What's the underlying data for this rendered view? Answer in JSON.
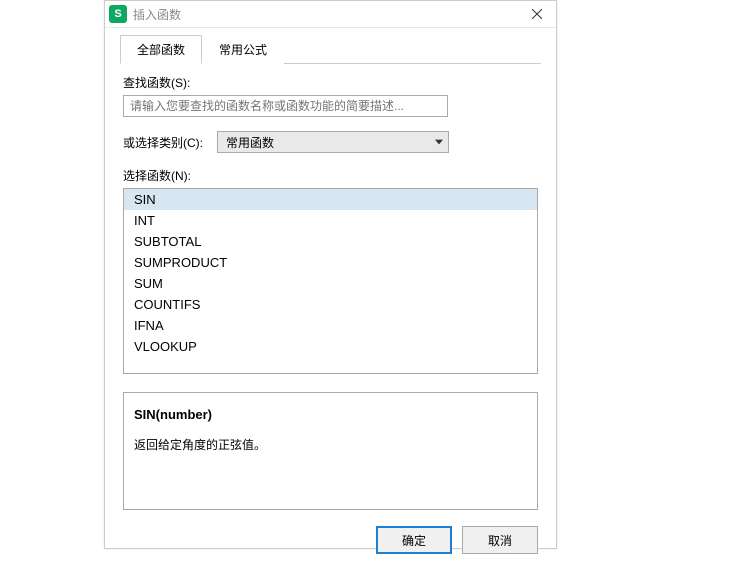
{
  "window": {
    "title": "插入函数"
  },
  "tabs": [
    {
      "label": "全部函数",
      "active": true
    },
    {
      "label": "常用公式",
      "active": false
    }
  ],
  "search": {
    "label": "查找函数(S):",
    "placeholder": "请输入您要查找的函数名称或函数功能的简要描述..."
  },
  "category": {
    "label": "或选择类别(C):",
    "selected": "常用函数"
  },
  "function_list": {
    "label": "选择函数(N):",
    "items": [
      "SIN",
      "INT",
      "SUBTOTAL",
      "SUMPRODUCT",
      "SUM",
      "COUNTIFS",
      "IFNA",
      "VLOOKUP"
    ],
    "selected_index": 0
  },
  "description": {
    "signature": "SIN(number)",
    "text": "返回给定角度的正弦值。"
  },
  "buttons": {
    "ok": "确定",
    "cancel": "取消"
  }
}
